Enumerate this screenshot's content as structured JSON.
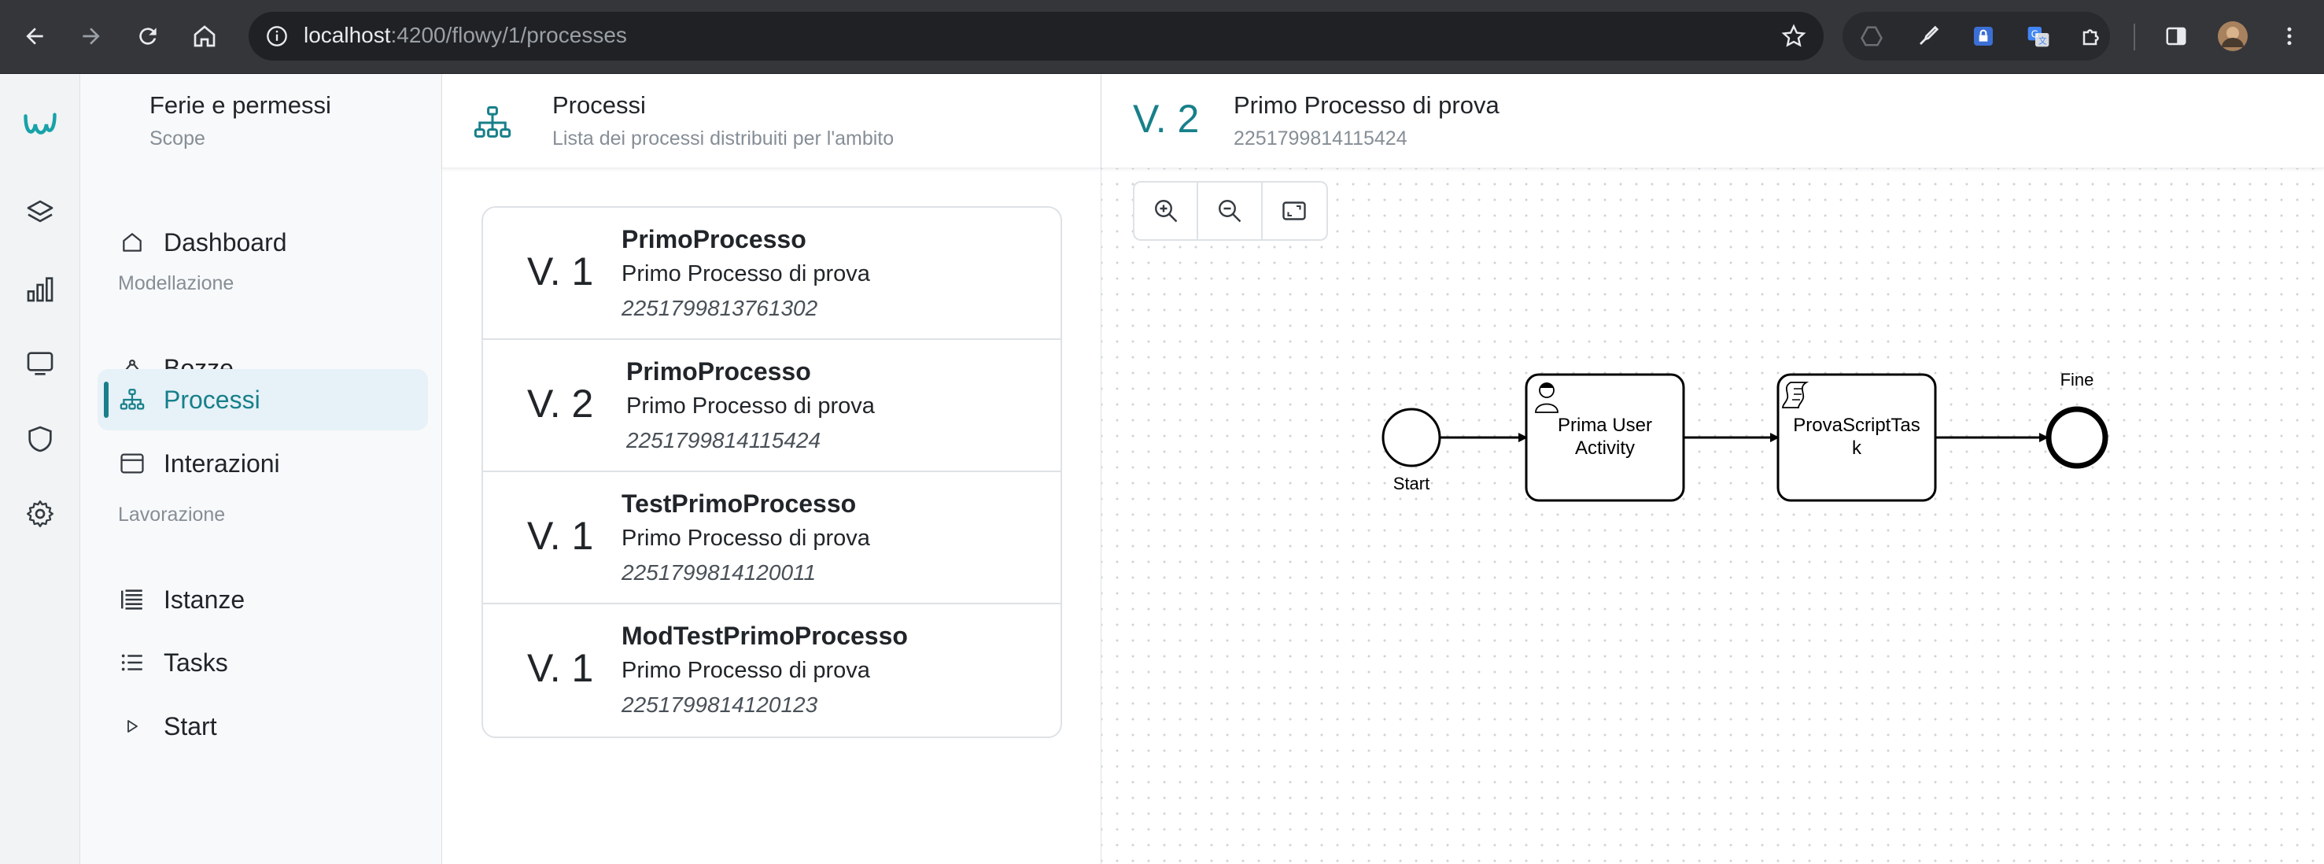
{
  "browser": {
    "url_host": "localhost",
    "url_path": ":4200/flowy/1/processes"
  },
  "sidebar": {
    "scope_title": "Ferie e permessi",
    "scope_subtitle": "Scope",
    "items": [
      {
        "label": "Dashboard",
        "icon": "home-icon"
      },
      {
        "label": "Bozze",
        "icon": "draft-icon"
      },
      {
        "label": "Processi",
        "icon": "process-icon",
        "active": true
      },
      {
        "label": "Interazioni",
        "icon": "interaction-icon"
      },
      {
        "label": "Istanze",
        "icon": "instances-icon"
      },
      {
        "label": "Tasks",
        "icon": "tasks-icon"
      },
      {
        "label": "Start",
        "icon": "play-icon"
      }
    ],
    "sections": [
      "Modellazione",
      "Lavorazione"
    ]
  },
  "processes": {
    "title": "Processi",
    "subtitle": "Lista dei processi distribuiti per l'ambito",
    "items": [
      {
        "version": "V. 1",
        "name": "PrimoProcesso",
        "description": "Primo Processo di prova",
        "code": "2251799813761302"
      },
      {
        "version": "V. 2",
        "name": "PrimoProcesso",
        "description": "Primo Processo di prova",
        "code": "2251799814115424"
      },
      {
        "version": "V. 1",
        "name": "TestPrimoProcesso",
        "description": "Primo Processo di prova",
        "code": "2251799814120011"
      },
      {
        "version": "V. 1",
        "name": "ModTestPrimoProcesso",
        "description": "Primo Processo di prova",
        "code": "2251799814120123"
      }
    ]
  },
  "detail": {
    "version": "V. 2",
    "title": "Primo Processo di prova",
    "code": "2251799814115424"
  },
  "diagram": {
    "start_label": "Start",
    "task1_line1": "Prima User",
    "task1_line2": "Activity",
    "task2_line1": "ProvaScriptTas",
    "task2_line2": "k",
    "end_label": "Fine"
  },
  "colors": {
    "accent": "#17808a",
    "chrome": "#35363a"
  }
}
